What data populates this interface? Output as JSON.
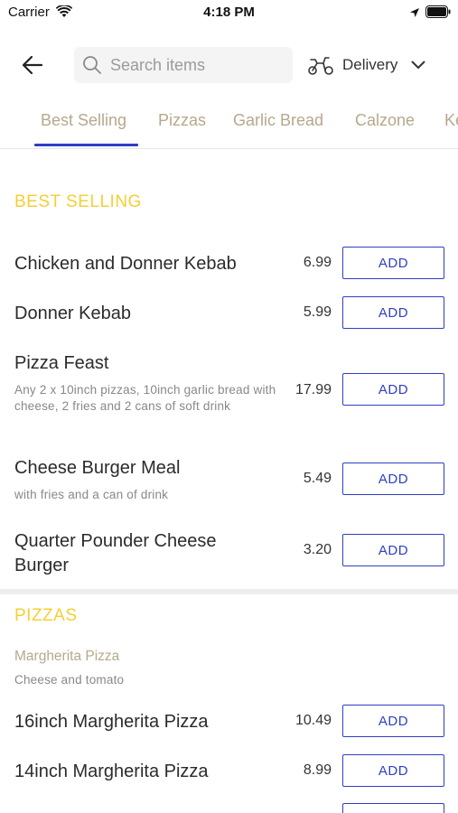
{
  "status_bar": {
    "carrier": "Carrier",
    "time": "4:18 PM"
  },
  "header": {
    "search_placeholder": "Search items",
    "delivery_label": "Delivery"
  },
  "tabs": [
    {
      "label": "Best Selling",
      "active": true
    },
    {
      "label": "Pizzas",
      "active": false
    },
    {
      "label": "Garlic Bread",
      "active": false
    },
    {
      "label": "Calzone",
      "active": false
    },
    {
      "label": "Ke",
      "active": false
    }
  ],
  "sections": {
    "best_selling": {
      "title": "BEST SELLING",
      "items": [
        {
          "name": "Chicken and Donner Kebab",
          "description": "",
          "price": "6.99",
          "button": "ADD"
        },
        {
          "name": "Donner Kebab",
          "description": "",
          "price": "5.99",
          "button": "ADD"
        },
        {
          "name": "Pizza Feast",
          "description": "Any 2 x 10inch pizzas, 10inch garlic bread with cheese, 2 fries and 2 cans of soft drink",
          "price": "17.99",
          "button": "ADD"
        },
        {
          "name": "Cheese Burger Meal",
          "description": "with fries and a can of drink",
          "price": "5.49",
          "button": "ADD"
        },
        {
          "name": "Quarter Pounder Cheese Burger",
          "description": "",
          "price": "3.20",
          "button": "ADD"
        }
      ]
    },
    "pizzas": {
      "title": "PIZZAS",
      "group_title": "Margherita Pizza",
      "group_desc": "Cheese and tomato",
      "items": [
        {
          "name": "16inch Margherita Pizza",
          "price": "10.49",
          "button": "ADD"
        },
        {
          "name": "14inch Margherita Pizza",
          "price": "8.99",
          "button": "ADD"
        }
      ]
    }
  },
  "colors": {
    "accent": "#2f3fc4",
    "section_title": "#f4cf36",
    "tab_text": "#b5a98c"
  }
}
